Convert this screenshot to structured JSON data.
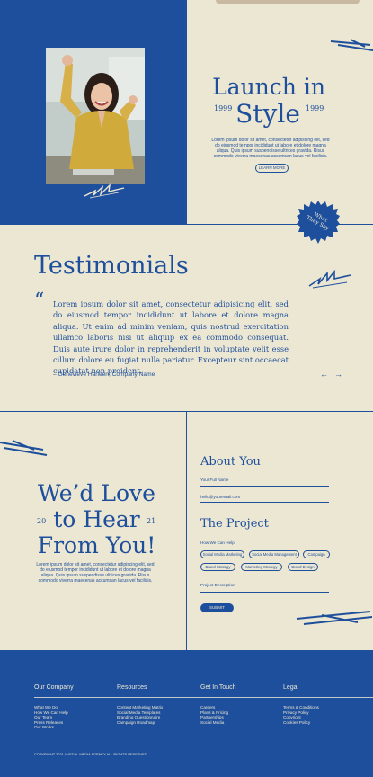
{
  "hero": {
    "title_line1": "Launch in",
    "title_line2": "Style",
    "year_left": "1999",
    "year_right": "1999",
    "body": "Lorem ipsum dolor sit amet, consectetur adipiscing elit, sed do eiusmod tempor incididunt ut labore et dolore magna aliqua. Quis ipsum suspendisse ultrices gravida. Risus commodo viverra maecenas accumsan lacus vel facilisis.",
    "button_label": "LEARN MORE",
    "badge_line1": "What",
    "badge_line2": "They Say"
  },
  "testimonials": {
    "title": "Testimonials",
    "quote_mark": "“",
    "quote": "Lorem ipsum dolor sit amet, consectetur adipisicing elit, sed do eiusmod tempor incididunt ut labore et dolore magna aliqua. Ut enim ad minim veniam, quis nostrud exercitation ullamco laboris nisi ut aliquip ex ea commodo consequat. Duis aute irure dolor in reprehenderit in voluptate velit esse cillum dolore eu fugiat nulla pariatur. Excepteur sint occaecat cupidatat non proident.",
    "author": "– Genevieve Harleen, Company Name",
    "prev_arrow": "←",
    "next_arrow": "→"
  },
  "contact": {
    "title_line1": "We’d Love",
    "title_line2": "to Hear",
    "title_line3": "From You!",
    "num_left": "20",
    "num_right": "21",
    "body": "Lorem ipsum dolor sit amet, consectetur adipiscing elit, sed do eiusmod tempor incididunt ut labore et dolore magna aliqua. Quis ipsum suspendisse ultrices gravida. Risus commodo viverra maecenas accumsan lacus vel facilisis.",
    "about_heading": "About You",
    "name_label": "Your Full Name",
    "email_value": "hello@youremail.com",
    "project_heading": "The Project",
    "help_label": "How We Can Help",
    "chips": [
      "Social Media Marketing",
      "Social Media Management",
      "Campaign",
      "Brand Strategy",
      "Marketing Strategy",
      "Brand Design"
    ],
    "description_label": "Project Description",
    "submit_label": "SUBMIT"
  },
  "footer": {
    "columns": [
      {
        "heading": "Our Company",
        "links": [
          "What We Do",
          "How We Can Help",
          "Our Team",
          "Press Releases",
          "Our Works"
        ]
      },
      {
        "heading": "Resources",
        "links": [
          "Content Marketing Matrix",
          "Social Media Templates",
          "Branding Questionnaire",
          "Campaign Roadmap"
        ]
      },
      {
        "heading": "Get In Touch",
        "links": [
          "Careers",
          "Plans & Pricing",
          "Partnerships",
          "Social Media"
        ]
      },
      {
        "heading": "Legal",
        "links": [
          "Terms & Conditions",
          "Privacy Policy",
          "Copyright",
          "Cookies Policy"
        ]
      }
    ],
    "copyright": "COPYRIGHT 2021 VUEDAL MEDIA AGENCY ALL RIGHTS RESERVED"
  },
  "colors": {
    "brand_blue": "#1e4f9c",
    "cream": "#ece7d2"
  }
}
